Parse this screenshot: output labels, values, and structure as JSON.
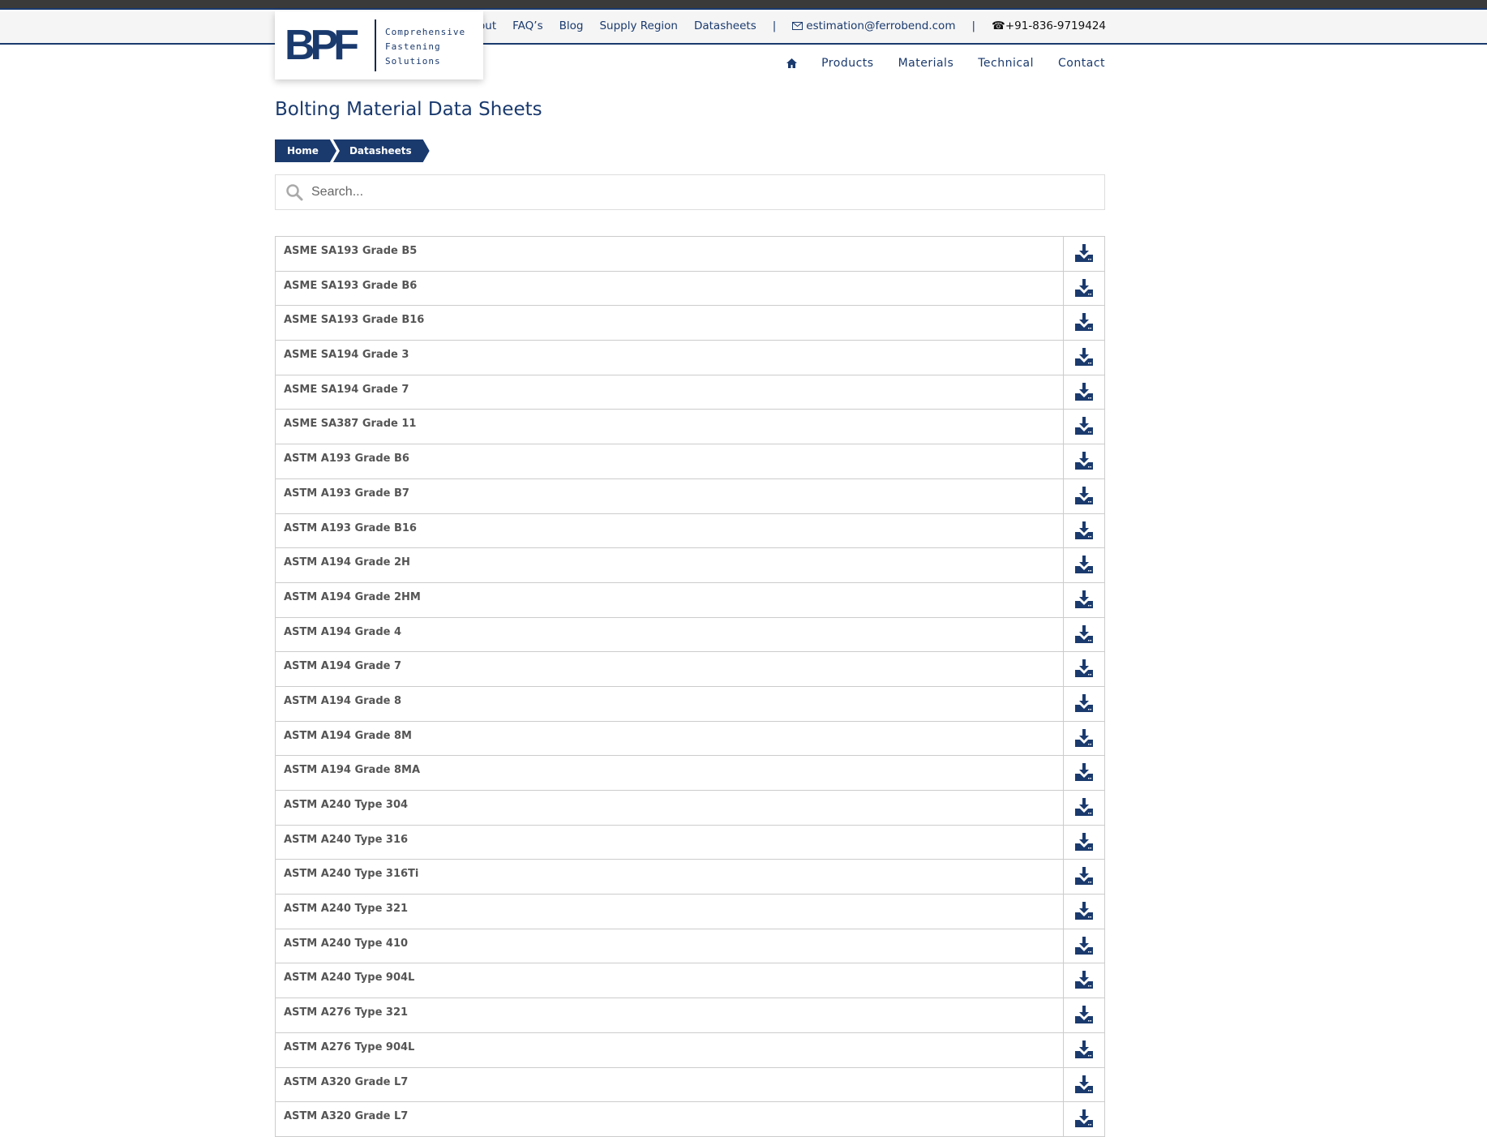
{
  "header": {
    "logo": {
      "letters": "BPF",
      "tagline": [
        "Comprehensive",
        "Fastening",
        "Solutions"
      ]
    },
    "top_links": [
      "About",
      "FAQ’s",
      "Blog",
      "Supply Region",
      "Datasheets"
    ],
    "email": "estimation@ferrobend.com",
    "phone": "+91-836-9719424",
    "separator": "|",
    "main_nav": [
      "Products",
      "Materials",
      "Technical",
      "Contact"
    ]
  },
  "page": {
    "title": "Bolting Material Data Sheets",
    "breadcrumb": [
      "Home",
      "Datasheets"
    ],
    "search_placeholder": "Search..."
  },
  "datasheets": [
    "ASME SA193 Grade B5",
    "ASME SA193 Grade B6",
    "ASME SA193 Grade B16",
    "ASME SA194 Grade 3",
    "ASME SA194 Grade 7",
    "ASME SA387 Grade 11",
    "ASTM A193 Grade B6",
    "ASTM A193 Grade B7",
    "ASTM A193 Grade B16",
    "ASTM A194 Grade 2H",
    "ASTM A194 Grade 2HM",
    "ASTM A194 Grade 4",
    "ASTM A194 Grade 7",
    "ASTM A194 Grade 8",
    "ASTM A194 Grade 8M",
    "ASTM A194 Grade 8MA",
    "ASTM A240 Type 304",
    "ASTM A240 Type 316",
    "ASTM A240 Type 316Ti",
    "ASTM A240 Type 321",
    "ASTM A240 Type 410",
    "ASTM A240 Type 904L",
    "ASTM A276 Type 321",
    "ASTM A276 Type 904L",
    "ASTM A320 Grade L7",
    "ASTM A320 Grade L7"
  ],
  "colors": {
    "brand": "#1a3a6e",
    "text": "#555555"
  }
}
